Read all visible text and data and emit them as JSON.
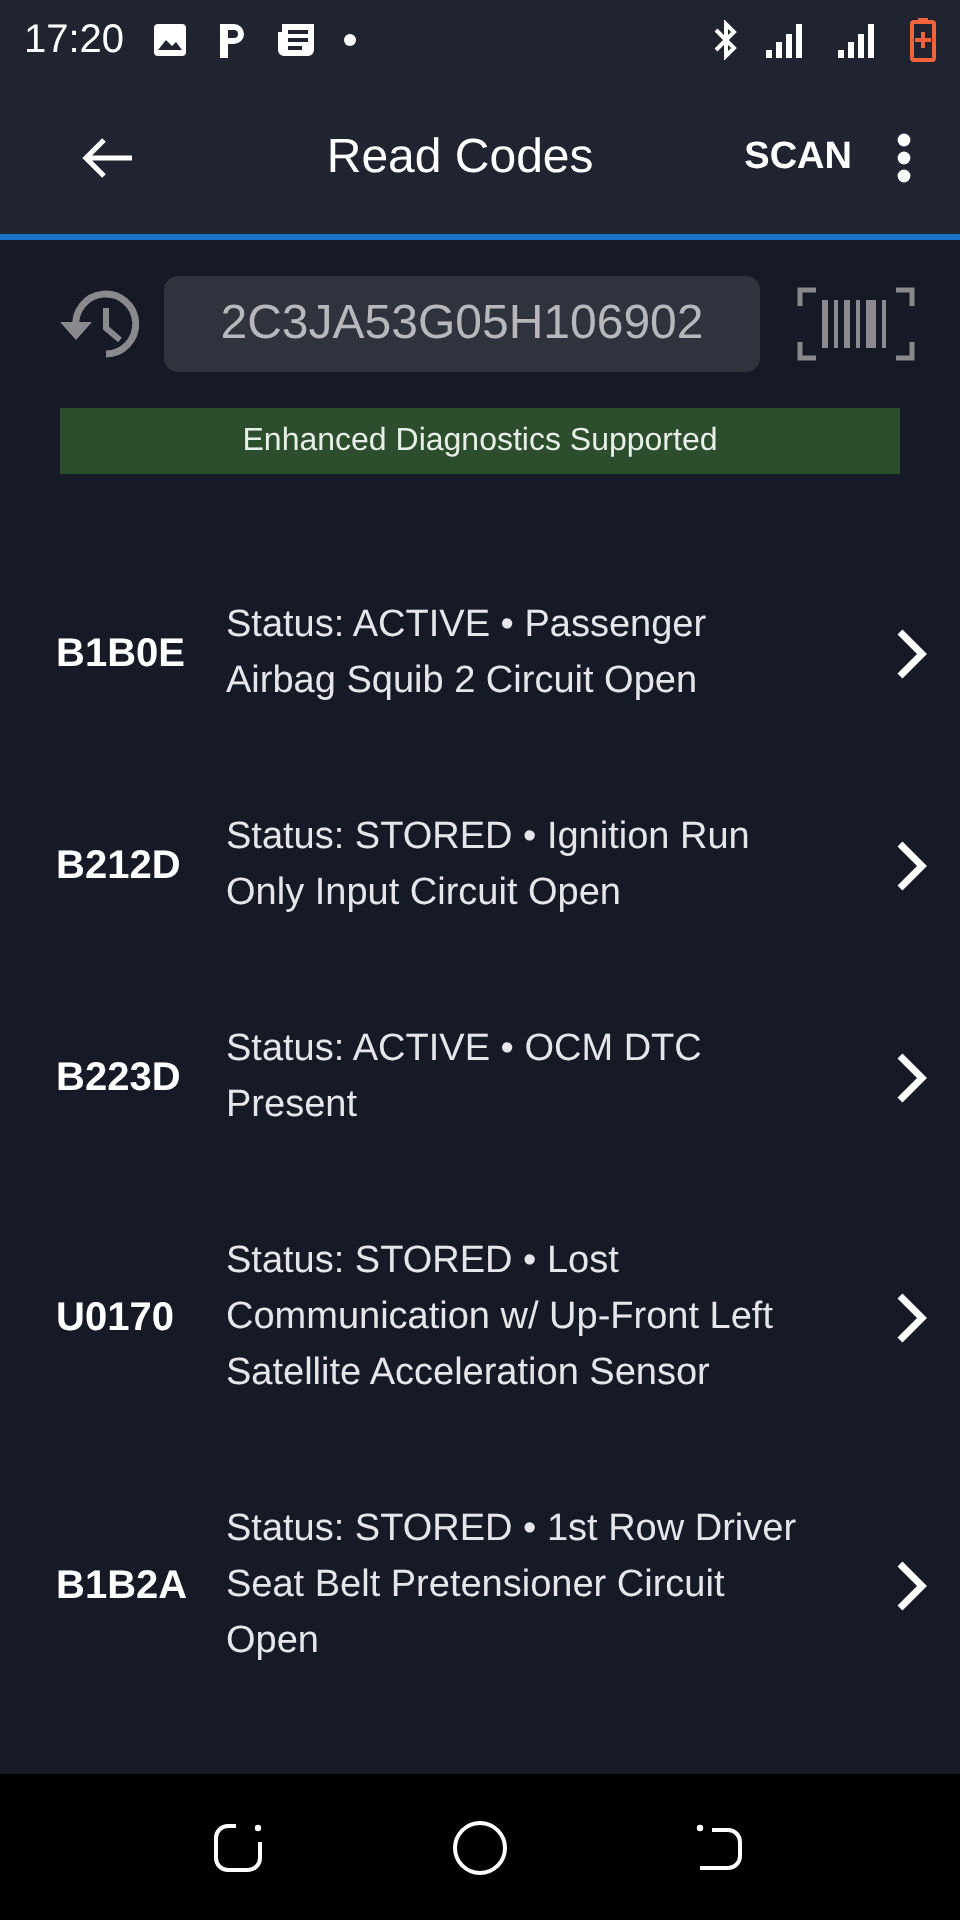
{
  "status_bar": {
    "time": "17:20"
  },
  "app_bar": {
    "title": "Read Codes",
    "action": "SCAN"
  },
  "vin_field": {
    "value": "2C3JA53G05H106902"
  },
  "banner": {
    "text": "Enhanced Diagnostics Supported"
  },
  "codes": [
    {
      "code": "B1B0E",
      "description": "Status: ACTIVE • Passenger Airbag Squib 2 Circuit Open"
    },
    {
      "code": "B212D",
      "description": "Status: STORED • Ignition Run Only Input Circuit Open"
    },
    {
      "code": "B223D",
      "description": "Status: ACTIVE • OCM DTC Present"
    },
    {
      "code": "U0170",
      "description": "Status: STORED • Lost Communication w/ Up-Front Left Satellite Acceleration Sensor"
    },
    {
      "code": "B1B2A",
      "description": "Status: STORED • 1st Row Driver Seat Belt Pretensioner Circuit Open"
    }
  ]
}
